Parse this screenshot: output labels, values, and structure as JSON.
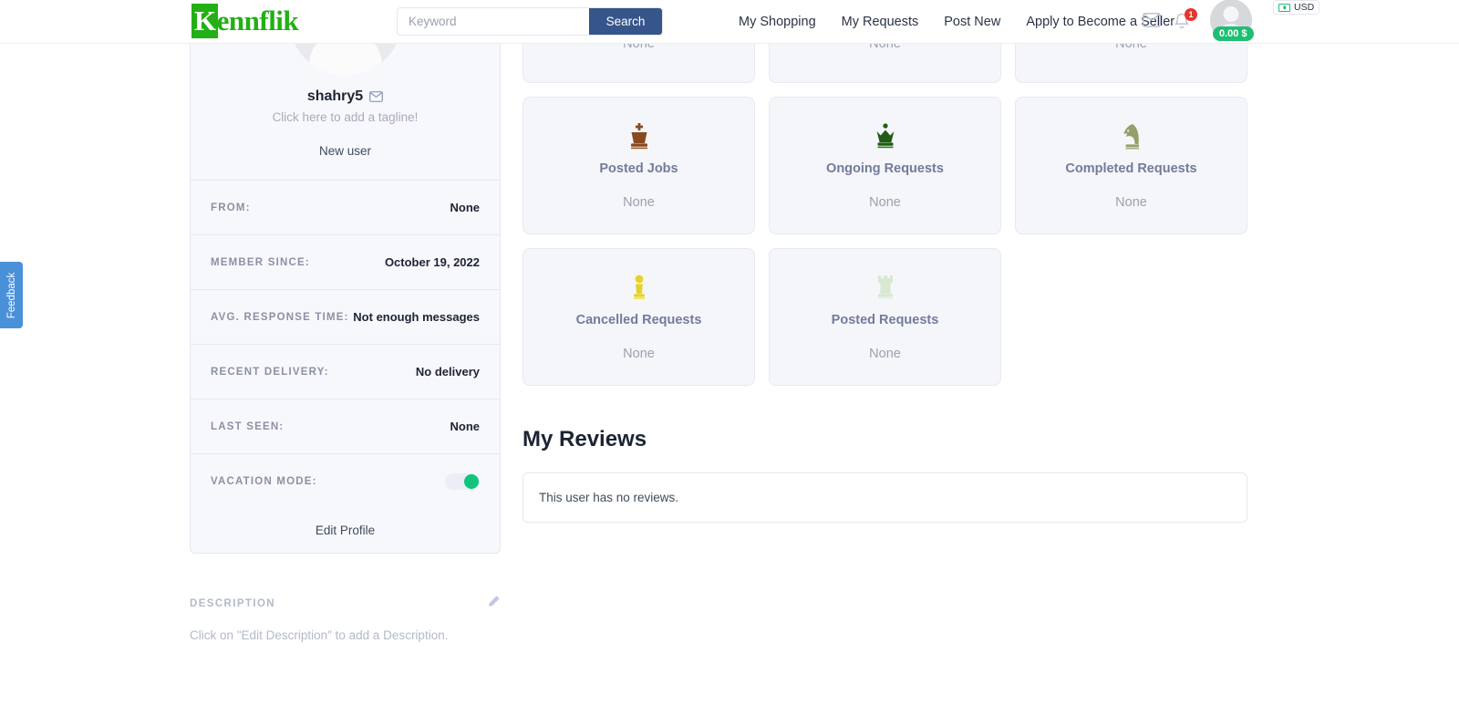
{
  "header": {
    "logo_text": "Kennflik",
    "logo_initial": "K",
    "logo_rest": "ennflik",
    "search": {
      "placeholder": "Keyword",
      "value": "",
      "button_label": "Search"
    },
    "nav": [
      {
        "label": "My Shopping"
      },
      {
        "label": "My Requests"
      },
      {
        "label": "Post New"
      },
      {
        "label": "Apply to Become a Seller"
      }
    ],
    "notification_count": "1",
    "balance": "0.00 $",
    "currency": "USD",
    "accent_color": "#36558a",
    "logo_color": "#22b014"
  },
  "feedback": {
    "label": "Feedback",
    "color": "#4a90d9"
  },
  "profile": {
    "username": "shahry5",
    "tagline": "Click here to add a tagline!",
    "status": "New user",
    "rows": [
      {
        "label": "From:",
        "value": "None"
      },
      {
        "label": "Member since:",
        "value": "October 19, 2022"
      },
      {
        "label": "Avg. Response Time:",
        "value": "Not enough messages"
      },
      {
        "label": "Recent Delivery:",
        "value": "No delivery"
      },
      {
        "label": "Last Seen:",
        "value": "None"
      }
    ],
    "vacation_label": "Vacation Mode:",
    "vacation_on": true,
    "edit_profile_label": "Edit Profile"
  },
  "description": {
    "title": "Description",
    "placeholder_text": "Click on \"Edit Description\" to add a Description."
  },
  "stats_partial_row": [
    {
      "value": "None"
    },
    {
      "value": "None"
    },
    {
      "value": "None"
    }
  ],
  "stats": [
    {
      "label": "Posted Jobs",
      "value": "None",
      "icon": "chess-king-icon",
      "color": "#8a4a20"
    },
    {
      "label": "Ongoing Requests",
      "value": "None",
      "icon": "chess-queen-icon",
      "color": "#1f5c14"
    },
    {
      "label": "Completed Requests",
      "value": "None",
      "icon": "chess-knight-icon",
      "color": "#93a06a"
    },
    {
      "label": "Cancelled Requests",
      "value": "None",
      "icon": "chess-pawn-icon",
      "color": "#e8d225"
    },
    {
      "label": "Posted Requests",
      "value": "None",
      "icon": "chess-rook-icon",
      "color": "#d8e8d2"
    }
  ],
  "reviews": {
    "heading": "My Reviews",
    "empty_text": "This user has no reviews."
  }
}
